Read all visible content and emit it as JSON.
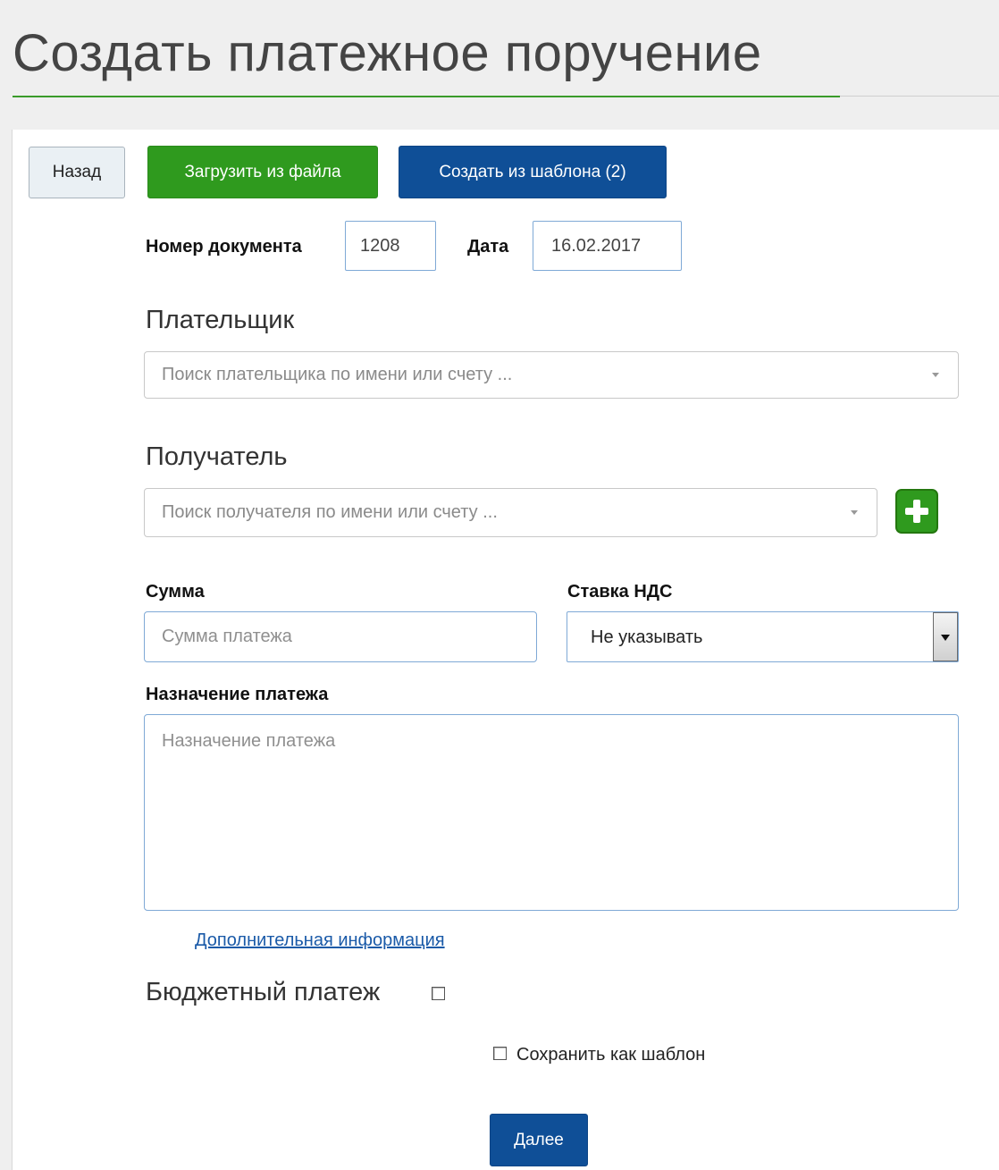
{
  "page": {
    "title": "Создать платежное поручение"
  },
  "toolbar": {
    "back_label": "Назад",
    "upload_label": "Загрузить из файла",
    "template_label": "Создать из шаблона (2)"
  },
  "document": {
    "number_label": "Номер документа",
    "number_value": "1208",
    "date_label": "Дата",
    "date_value": "16.02.2017"
  },
  "payer": {
    "title": "Плательщик",
    "placeholder": "Поиск плательщика по имени или счету ..."
  },
  "recipient": {
    "title": "Получатель",
    "placeholder": "Поиск получателя по имени или счету ...",
    "add_icon": "plus-icon"
  },
  "amount": {
    "label": "Сумма",
    "placeholder": "Сумма платежа",
    "value": ""
  },
  "vat": {
    "label": "Ставка НДС",
    "selected": "Не указывать"
  },
  "purpose": {
    "label": "Назначение платежа",
    "placeholder": "Назначение платежа",
    "value": ""
  },
  "additional_info_link": "Дополнительная информация",
  "budget_payment": {
    "label": "Бюджетный платеж",
    "checked": false
  },
  "save_template": {
    "label": "Сохранить как шаблон",
    "checked": false
  },
  "next_label": "Далее",
  "colors": {
    "green": "#2f9a1e",
    "blue": "#0f4f97",
    "link": "#1a5aa8",
    "input_border": "#7fa9d6"
  }
}
